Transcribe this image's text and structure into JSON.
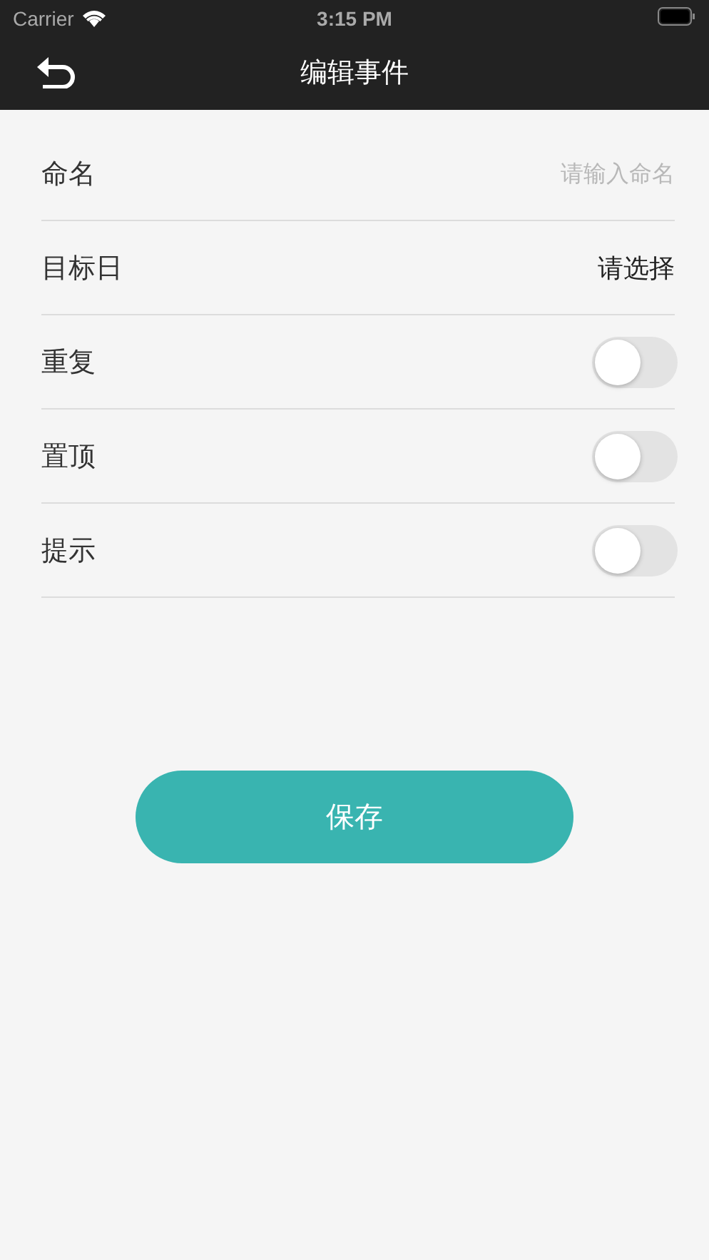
{
  "status_bar": {
    "carrier": "Carrier",
    "time": "3:15 PM"
  },
  "nav": {
    "title": "编辑事件"
  },
  "rows": [
    {
      "kind": "input",
      "label": "命名",
      "placeholder": "请输入命名"
    },
    {
      "kind": "picker",
      "label": "目标日",
      "value": "请选择"
    },
    {
      "kind": "toggle",
      "label": "重复",
      "on": false
    },
    {
      "kind": "toggle",
      "label": "置顶",
      "on": false
    },
    {
      "kind": "toggle",
      "label": "提示",
      "on": false
    }
  ],
  "save_button": "保存"
}
